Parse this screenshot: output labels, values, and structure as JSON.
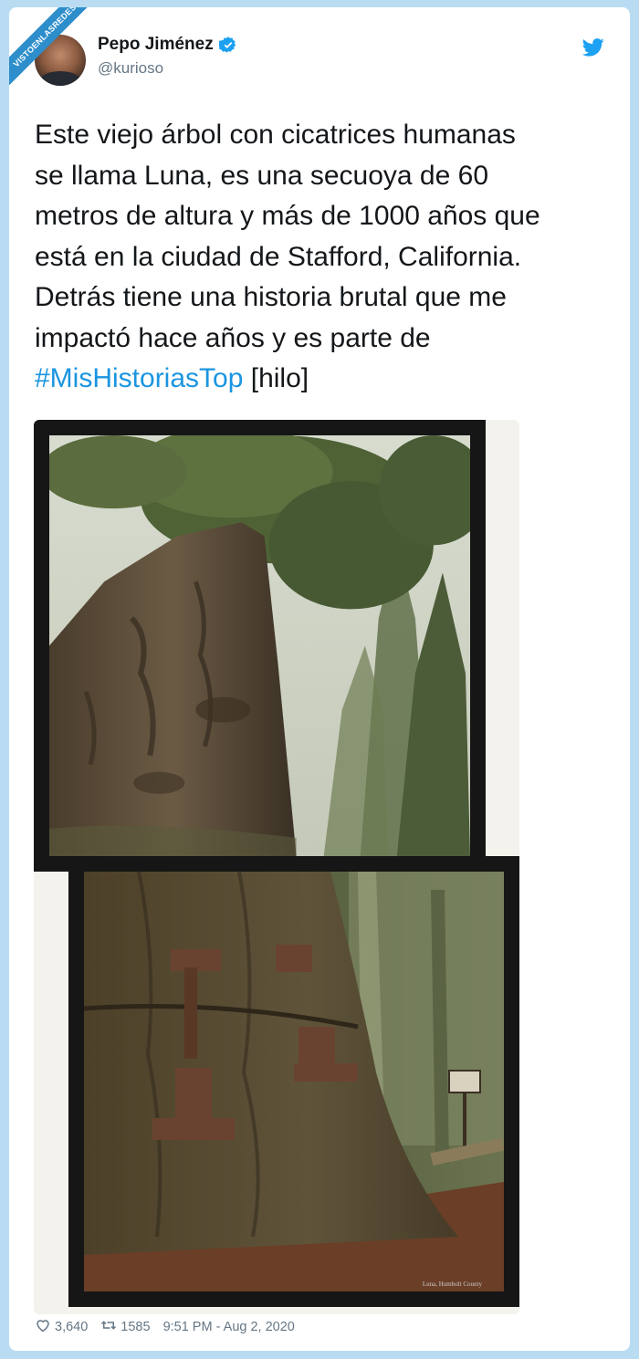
{
  "watermark": {
    "label": "VISTOENLASREDES"
  },
  "tweet": {
    "author_name": "Pepo Jiménez",
    "author_handle": "@kurioso",
    "text_lines": [
      "Este viejo árbol con cicatrices humanas",
      "se llama Luna, es una secuoya de 60",
      "metros de altura y más de 1000 años que",
      "está en la ciudad de Stafford, California.",
      "Detrás tiene una historia brutal que me",
      "impactó hace años y es parte de"
    ],
    "hashtag": "#MisHistoriasTop",
    "text_suffix": " [hilo]",
    "photo_caption": "Luna, Humbolt County",
    "likes": "3,640",
    "retweets": "1585",
    "timestamp": "9:51 PM - Aug 2, 2020"
  },
  "icons": {
    "verified": "verified-badge-icon",
    "bird": "twitter-bird-icon",
    "like": "heart-icon",
    "retweet": "retweet-icon"
  },
  "colors": {
    "background": "#b9dcf2",
    "accent": "#1da1f2",
    "hashtag": "#1b95e0",
    "muted": "#657786",
    "ribbon": "#2d8ecb"
  }
}
